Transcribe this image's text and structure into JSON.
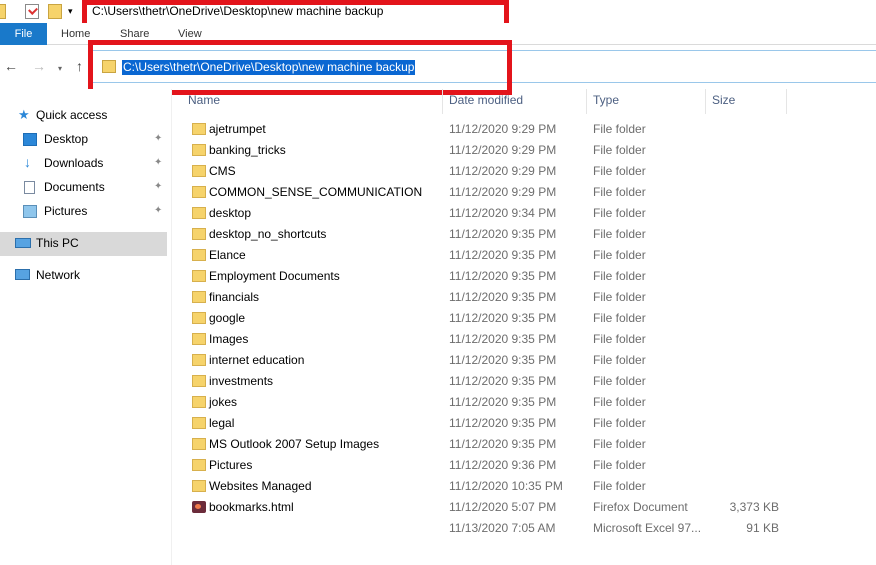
{
  "title_bar": {
    "path": "C:\\Users\\thetr\\OneDrive\\Desktop\\new machine backup",
    "dropdown_glyph": "▾"
  },
  "ribbon": {
    "tabs": [
      "File",
      "Home",
      "Share",
      "View"
    ]
  },
  "nav": {
    "back_icon": "←",
    "forward_icon": "→",
    "recent_icon": "▾",
    "up_icon": "↑",
    "address": "C:\\Users\\thetr\\OneDrive\\Desktop\\new machine backup"
  },
  "sidebar": {
    "quick_access": "Quick access",
    "items": [
      {
        "label": "Desktop",
        "icon": "desktop-icon",
        "pinned": true
      },
      {
        "label": "Downloads",
        "icon": "downloads-icon",
        "pinned": true
      },
      {
        "label": "Documents",
        "icon": "documents-icon",
        "pinned": true
      },
      {
        "label": "Pictures",
        "icon": "pictures-icon",
        "pinned": true
      }
    ],
    "this_pc": "This PC",
    "network": "Network",
    "pin_glyph": "📌"
  },
  "columns": {
    "name": "Name",
    "date": "Date modified",
    "type": "Type",
    "size": "Size"
  },
  "files": [
    {
      "name": "ajetrumpet",
      "date": "11/12/2020 9:29 PM",
      "type": "File folder",
      "size": "",
      "icon": "folder-icon"
    },
    {
      "name": "banking_tricks",
      "date": "11/12/2020 9:29 PM",
      "type": "File folder",
      "size": "",
      "icon": "folder-icon"
    },
    {
      "name": "CMS",
      "date": "11/12/2020 9:29 PM",
      "type": "File folder",
      "size": "",
      "icon": "folder-icon"
    },
    {
      "name": "COMMON_SENSE_COMMUNICATION",
      "date": "11/12/2020 9:29 PM",
      "type": "File folder",
      "size": "",
      "icon": "folder-icon"
    },
    {
      "name": "desktop",
      "date": "11/12/2020 9:34 PM",
      "type": "File folder",
      "size": "",
      "icon": "folder-icon"
    },
    {
      "name": "desktop_no_shortcuts",
      "date": "11/12/2020 9:35 PM",
      "type": "File folder",
      "size": "",
      "icon": "folder-icon"
    },
    {
      "name": "Elance",
      "date": "11/12/2020 9:35 PM",
      "type": "File folder",
      "size": "",
      "icon": "folder-icon"
    },
    {
      "name": "Employment Documents",
      "date": "11/12/2020 9:35 PM",
      "type": "File folder",
      "size": "",
      "icon": "folder-icon"
    },
    {
      "name": "financials",
      "date": "11/12/2020 9:35 PM",
      "type": "File folder",
      "size": "",
      "icon": "folder-icon"
    },
    {
      "name": "google",
      "date": "11/12/2020 9:35 PM",
      "type": "File folder",
      "size": "",
      "icon": "folder-icon"
    },
    {
      "name": "Images",
      "date": "11/12/2020 9:35 PM",
      "type": "File folder",
      "size": "",
      "icon": "folder-icon"
    },
    {
      "name": "internet education",
      "date": "11/12/2020 9:35 PM",
      "type": "File folder",
      "size": "",
      "icon": "folder-icon"
    },
    {
      "name": "investments",
      "date": "11/12/2020 9:35 PM",
      "type": "File folder",
      "size": "",
      "icon": "folder-icon"
    },
    {
      "name": "jokes",
      "date": "11/12/2020 9:35 PM",
      "type": "File folder",
      "size": "",
      "icon": "folder-icon"
    },
    {
      "name": "legal",
      "date": "11/12/2020 9:35 PM",
      "type": "File folder",
      "size": "",
      "icon": "folder-icon"
    },
    {
      "name": "MS Outlook 2007 Setup Images",
      "date": "11/12/2020 9:35 PM",
      "type": "File folder",
      "size": "",
      "icon": "folder-icon"
    },
    {
      "name": "Pictures",
      "date": "11/12/2020 9:36 PM",
      "type": "File folder",
      "size": "",
      "icon": "folder-icon"
    },
    {
      "name": "Websites Managed",
      "date": "11/12/2020 10:35 PM",
      "type": "File folder",
      "size": "",
      "icon": "folder-icon"
    },
    {
      "name": "bookmarks.html",
      "date": "11/12/2020 5:07 PM",
      "type": "Firefox Document",
      "size": "3,373 KB",
      "icon": "html-file-icon"
    },
    {
      "name": "",
      "date": "11/13/2020 7:05 AM",
      "type": "Microsoft Excel 97...",
      "size": "91 KB",
      "icon": ""
    }
  ],
  "colors": {
    "file_tab": "#1979ca",
    "address_highlight": "#0a67d2",
    "annotation_red": "#e3141b",
    "folder_yellow": "#f6d36b"
  }
}
